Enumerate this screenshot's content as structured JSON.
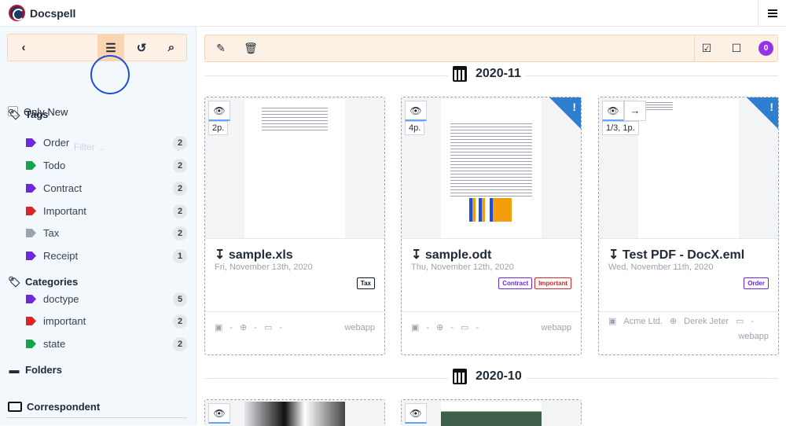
{
  "app": {
    "name": "Docspell"
  },
  "sidebar": {
    "only_new_label": "Only New",
    "tags": {
      "title": "Tags",
      "filter_placeholder": "Filter ...",
      "items": [
        {
          "label": "Order",
          "count": "2",
          "color": "#6d28d9"
        },
        {
          "label": "Todo",
          "count": "2",
          "color": "#16a34a"
        },
        {
          "label": "Contract",
          "count": "2",
          "color": "#6d28d9"
        },
        {
          "label": "Important",
          "count": "2",
          "color": "#dc2626"
        },
        {
          "label": "Tax",
          "count": "2",
          "color": "#9ca3af"
        },
        {
          "label": "Receipt",
          "count": "1",
          "color": "#6d28d9"
        }
      ]
    },
    "categories": {
      "title": "Categories",
      "items": [
        {
          "label": "doctype",
          "count": "5",
          "color": "#6d28d9"
        },
        {
          "label": "important",
          "count": "2",
          "color": "#dc2626"
        },
        {
          "label": "state",
          "count": "2",
          "color": "#16a34a"
        }
      ]
    },
    "folders_title": "Folders",
    "correspondent_title": "Correspondent"
  },
  "toolbar": {
    "selected_count": "0"
  },
  "groups": [
    {
      "label": "2020-11",
      "cards": [
        {
          "pages": "2p.",
          "title": "sample.xls",
          "date": "Fri, November 13th, 2020",
          "tags": [
            {
              "label": "Tax",
              "color": "#111827"
            }
          ],
          "correspondent": "-",
          "concerning": "-",
          "folder": "-",
          "source": "webapp",
          "new": false
        },
        {
          "pages": "4p.",
          "title": "sample.odt",
          "date": "Thu, November 12th, 2020",
          "tags": [
            {
              "label": "Contract",
              "color": "#6d28d9"
            },
            {
              "label": "Important",
              "color": "#dc2626"
            }
          ],
          "correspondent": "-",
          "concerning": "-",
          "folder": "-",
          "source": "webapp",
          "new": true,
          "doc_heading": "Lorem ipsum"
        },
        {
          "pages": "1/3, 1p.",
          "title": "Test PDF - DocX.eml",
          "date": "Wed, November 11th, 2020",
          "tags": [
            {
              "label": "Order",
              "color": "#6d28d9"
            }
          ],
          "correspondent": "Acme Ltd.",
          "concerning": "Derek Jeter",
          "folder": "-",
          "source": "webapp",
          "new": true
        }
      ]
    },
    {
      "label": "2020-10"
    }
  ]
}
